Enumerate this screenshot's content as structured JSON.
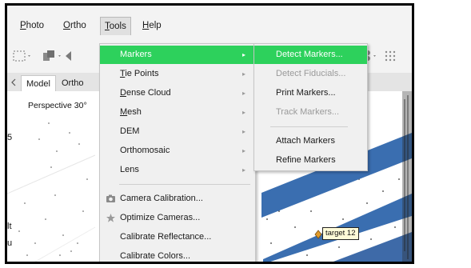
{
  "menubar": {
    "items": [
      {
        "label": "Photo",
        "u": "P",
        "rest": "hoto"
      },
      {
        "label": "Ortho",
        "u": "O",
        "rest": "rtho"
      },
      {
        "label": "Tools",
        "u": "T",
        "rest": "ools"
      },
      {
        "label": "Help",
        "u": "H",
        "rest": "elp"
      }
    ]
  },
  "tabs": [
    {
      "label": "Model"
    },
    {
      "label": "Ortho"
    }
  ],
  "viewport": {
    "perspective_label": "Perspective 30°",
    "left_fragments": [
      "5",
      "lt",
      "u"
    ],
    "target_label": "target 12"
  },
  "tools_menu": {
    "items": [
      {
        "label": "Markers",
        "arrow": "▸"
      },
      {
        "u": "T",
        "rest": "ie Points",
        "arrow": "▸"
      },
      {
        "u": "D",
        "rest": "ense Cloud",
        "arrow": "▸"
      },
      {
        "u": "M",
        "rest": "esh",
        "arrow": "▸"
      },
      {
        "label": "DEM",
        "arrow": "▸"
      },
      {
        "label": "Orthomosaic",
        "arrow": "▸"
      },
      {
        "label": "Lens",
        "arrow": "▸"
      },
      {
        "label": "Camera Calibration..."
      },
      {
        "label": "Optimize Cameras..."
      },
      {
        "label": "Calibrate Reflectance..."
      },
      {
        "label": "Calibrate Colors..."
      }
    ],
    "icons": {
      "camera_calibration": "camera-icon",
      "optimize_cameras": "star-icon"
    }
  },
  "markers_submenu": {
    "items": [
      {
        "label": "Detect Markers..."
      },
      {
        "label": "Detect Fiducials..."
      },
      {
        "label": "Print Markers..."
      },
      {
        "label": "Track Markers..."
      },
      {
        "label": "Attach Markers"
      },
      {
        "label": "Refine Markers"
      }
    ]
  },
  "colors": {
    "highlight": "#2dd15c",
    "road": "#3a6eb0"
  }
}
